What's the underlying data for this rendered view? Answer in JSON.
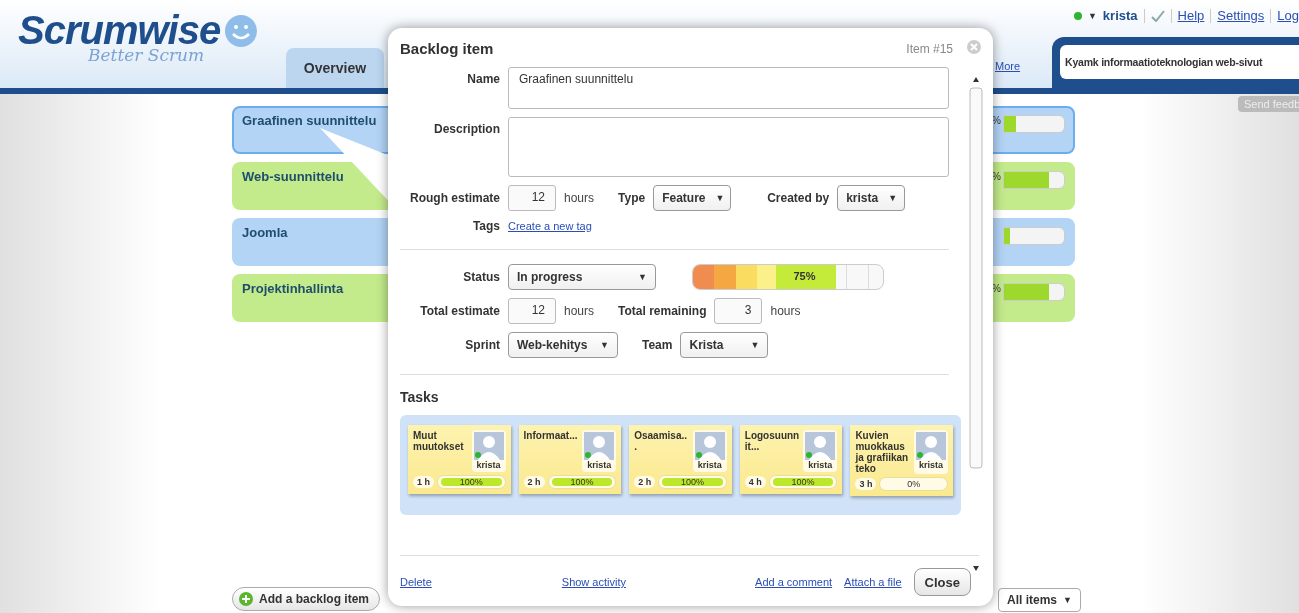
{
  "header": {
    "logo": "Scrumwise",
    "tagline": "Better Scrum",
    "tabs": [
      {
        "label": "Overview",
        "selected": false
      }
    ],
    "more_link": "More",
    "user": {
      "name": "krista",
      "online": true
    },
    "links": [
      "Help",
      "Settings",
      "Log"
    ],
    "project": "Kyamk informaatioteknologian web-sivut",
    "feedback": "Send feedb"
  },
  "backlog": [
    {
      "name": "Graafinen suunnittelu",
      "color": "#b3d4f5",
      "selected": true,
      "fragment": "%",
      "level": 0.2
    },
    {
      "name": "Web-suunnittelu",
      "color": "#c3eb8c",
      "selected": false,
      "fragment": "%",
      "level": 0.75
    },
    {
      "name": "Joomla",
      "color": "#b3d4f5",
      "selected": false,
      "level": 0.1
    },
    {
      "name": "Projektinhallinta",
      "color": "#c3eb8c",
      "selected": false,
      "fragment": "%",
      "level": 0.75
    }
  ],
  "caret": "▼",
  "add_button": "Add a backlog item",
  "filter": "All items",
  "dialog": {
    "title": "Backlog item",
    "item_number": "Item #15",
    "name_label": "Name",
    "name_value": "Graafinen suunnittelu",
    "description_label": "Description",
    "rough_label": "Rough estimate",
    "rough_value": "12",
    "rough_unit": "hours",
    "type_label": "Type",
    "type_value": "Feature",
    "created_label": "Created by",
    "created_value": "krista",
    "tags_label": "Tags",
    "tags_link": "Create a new tag",
    "status_label": "Status",
    "status_value": "In progress",
    "status_level": {
      "level": 0.75,
      "text": "75%"
    },
    "total_estimate_label": "Total estimate",
    "total_estimate": "12",
    "total_estimate_unit": "hours",
    "total_remaining_label": "Total remaining",
    "total_remaining": "3",
    "total_remaining_unit": "hours",
    "sprint_label": "Sprint",
    "sprint_value": "Web-kehitys",
    "team_label": "Team",
    "team_value": "Krista",
    "tasks_title": "Tasks",
    "tasks": [
      {
        "name": "Muut muutokset",
        "user": "krista",
        "hours": "1 h",
        "level": 1,
        "percent": "100%"
      },
      {
        "name": "Informaat...",
        "user": "krista",
        "hours": "2 h",
        "level": 1,
        "percent": "100%"
      },
      {
        "name": "Osaamisa...",
        "user": "krista",
        "hours": "2 h",
        "level": 1,
        "percent": "100%"
      },
      {
        "name": "Logosuunnit...",
        "user": "krista",
        "hours": "4 h",
        "level": 1,
        "percent": "100%"
      },
      {
        "name": "Kuvien muokkaus ja grafiikan teko",
        "user": "krista",
        "hours": "3 h",
        "level": 0,
        "percent": "0%"
      }
    ],
    "footer_links": [
      "Delete",
      "Show activity",
      "Add a comment",
      "Attach a file"
    ],
    "close_button": "Close"
  }
}
